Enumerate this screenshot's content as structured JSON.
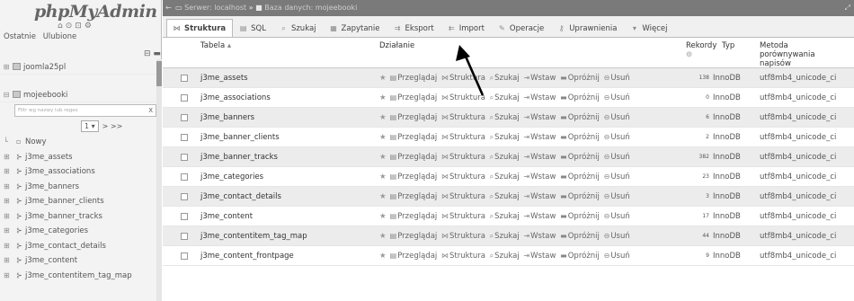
{
  "nav": {
    "logo_php": "php",
    "logo_myadmin": "MyAdmin",
    "recent_label": "Ostatnie",
    "favorites_label": "Ulubione",
    "server_node": "joomla25pl",
    "database_node": "mojeebooki",
    "filter_placeholder": "Filtr wg nazwy lub regex",
    "filter_clear": "X",
    "page_select": "1 ▾",
    "page_next": "> >>",
    "new_label": "Nowy",
    "tables": [
      {
        "name": "j3me_assets"
      },
      {
        "name": "j3me_associations"
      },
      {
        "name": "j3me_banners"
      },
      {
        "name": "j3me_banner_clients"
      },
      {
        "name": "j3me_banner_tracks"
      },
      {
        "name": "j3me_categories"
      },
      {
        "name": "j3me_contact_details"
      },
      {
        "name": "j3me_content"
      },
      {
        "name": "j3me_contentitem_tag_map"
      }
    ]
  },
  "breadcrumb": {
    "server": "Serwer: localhost",
    "separator": "»",
    "database": "Baza danych: mojeebooki"
  },
  "tabs": [
    {
      "label": "Struktura",
      "icon": "structure-icon",
      "glyph": "⋈",
      "active": true
    },
    {
      "label": "SQL",
      "icon": "sql-icon",
      "glyph": "▤",
      "active": false
    },
    {
      "label": "Szukaj",
      "icon": "search-icon",
      "glyph": "⌕",
      "active": false
    },
    {
      "label": "Zapytanie",
      "icon": "query-icon",
      "glyph": "▦",
      "active": false
    },
    {
      "label": "Eksport",
      "icon": "export-icon",
      "glyph": "⇉",
      "active": false
    },
    {
      "label": "Import",
      "icon": "import-icon",
      "glyph": "⇇",
      "active": false
    },
    {
      "label": "Operacje",
      "icon": "operations-icon",
      "glyph": "✎",
      "active": false
    },
    {
      "label": "Uprawnienia",
      "icon": "privileges-icon",
      "glyph": "⚷",
      "active": false
    },
    {
      "label": "Więcej",
      "icon": "more-icon",
      "glyph": "▾",
      "active": false
    }
  ],
  "grid": {
    "headers": {
      "table": "Tabela",
      "actions": "Działanie",
      "records": "Rekordy",
      "type": "Typ",
      "collation_line1": "Metoda",
      "collation_line2": "porównywania",
      "collation_line3": "napisów"
    },
    "actions": {
      "browse": "Przeglądaj",
      "structure": "Struktura",
      "search": "Szukaj",
      "insert": "Wstaw",
      "empty": "Opróżnij",
      "drop": "Usuń"
    },
    "rows": [
      {
        "name": "j3me_assets",
        "records": "138",
        "type": "InnoDB",
        "collation": "utf8mb4_unicode_ci"
      },
      {
        "name": "j3me_associations",
        "records": "0",
        "type": "InnoDB",
        "collation": "utf8mb4_unicode_ci"
      },
      {
        "name": "j3me_banners",
        "records": "6",
        "type": "InnoDB",
        "collation": "utf8mb4_unicode_ci"
      },
      {
        "name": "j3me_banner_clients",
        "records": "2",
        "type": "InnoDB",
        "collation": "utf8mb4_unicode_ci"
      },
      {
        "name": "j3me_banner_tracks",
        "records": "382",
        "type": "InnoDB",
        "collation": "utf8mb4_unicode_ci"
      },
      {
        "name": "j3me_categories",
        "records": "23",
        "type": "InnoDB",
        "collation": "utf8mb4_unicode_ci"
      },
      {
        "name": "j3me_contact_details",
        "records": "3",
        "type": "InnoDB",
        "collation": "utf8mb4_unicode_ci"
      },
      {
        "name": "j3me_content",
        "records": "17",
        "type": "InnoDB",
        "collation": "utf8mb4_unicode_ci"
      },
      {
        "name": "j3me_contentitem_tag_map",
        "records": "44",
        "type": "InnoDB",
        "collation": "utf8mb4_unicode_ci"
      },
      {
        "name": "j3me_content_frontpage",
        "records": "9",
        "type": "InnoDB",
        "collation": "utf8mb4_unicode_ci"
      }
    ]
  },
  "colors": {
    "breadcrumb_bg": "#7a7a7a",
    "nav_bg": "#f3f3f3",
    "arrow": "#000000"
  }
}
